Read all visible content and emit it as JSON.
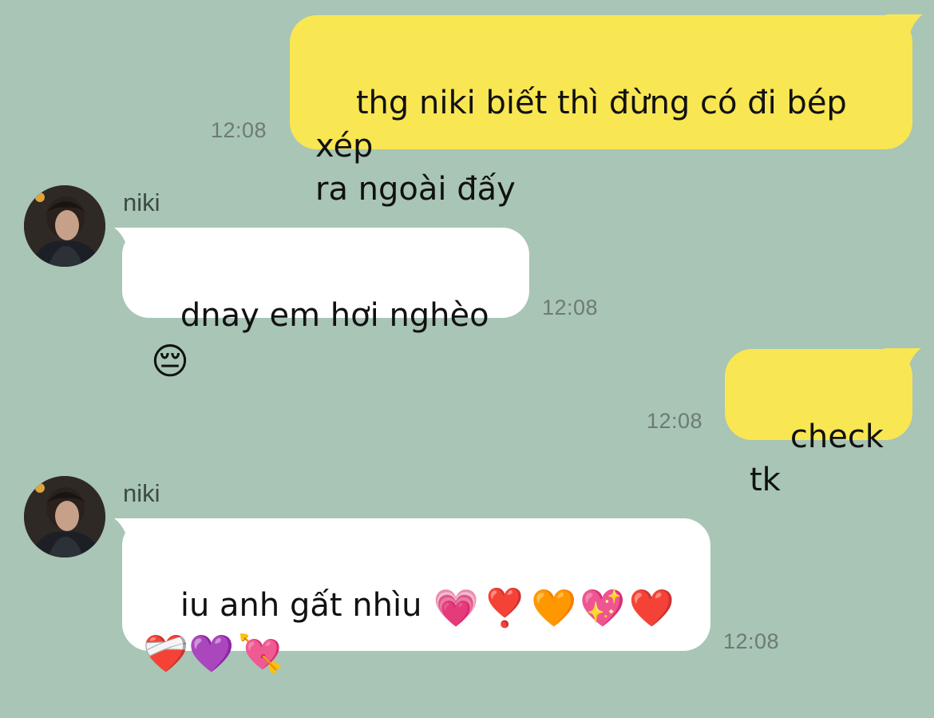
{
  "chat": {
    "messages": [
      {
        "from": "me",
        "text": "thg niki biết thì đừng có đi bép xép\nra ngoài đấy",
        "time": "12:08"
      },
      {
        "from": "niki",
        "sender": "niki",
        "text": "dnay em hơi nghèo",
        "emojis": [
          "😔"
        ],
        "time": "12:08"
      },
      {
        "from": "me",
        "text": "check tk",
        "time": "12:08"
      },
      {
        "from": "niki",
        "sender": "niki",
        "text": "iu anh gất nhìu",
        "emojis": [
          "💗",
          "❣️",
          "🧡",
          "💖",
          "❤️",
          "❤️‍🩹",
          "💜",
          "💘"
        ],
        "time": "12:08"
      }
    ]
  },
  "colors": {
    "background": "#a8c5b5",
    "outgoing_bubble": "#f9e653",
    "incoming_bubble": "#ffffff",
    "timestamp": "#6d7b74"
  }
}
